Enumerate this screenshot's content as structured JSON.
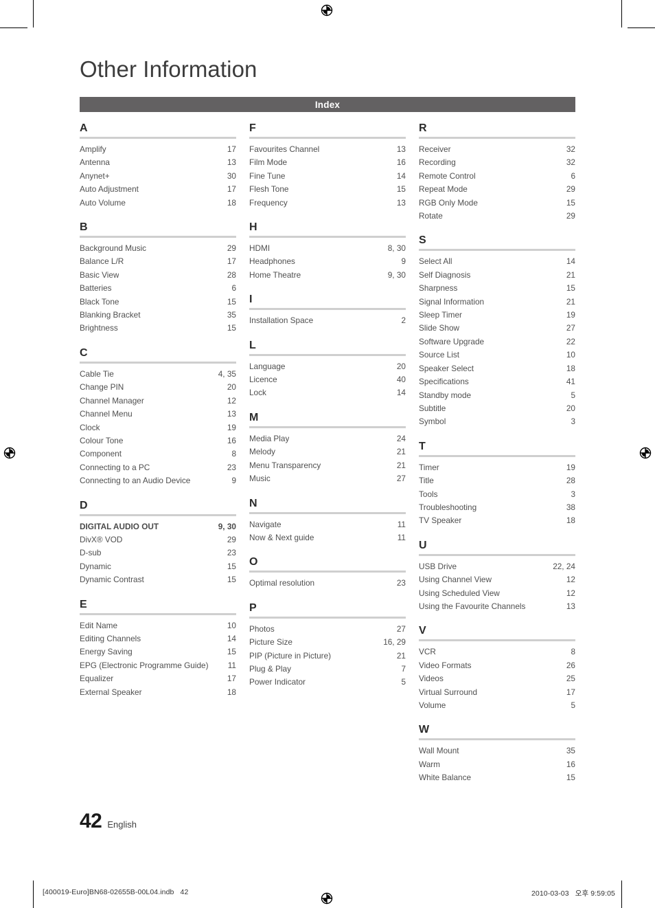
{
  "document": {
    "chapter_title": "Other Information",
    "section_bar_label": "Index",
    "page_number": "42",
    "language": "English",
    "slug_left": "[400019-Euro]BN68-02655B-00L04.indb   42",
    "slug_right": "2010-03-03   오후 9:59:05",
    "accent_bar_color": "#636162",
    "rule_color": "#cfcfcf",
    "text_color": "#4f4f4f"
  },
  "index": {
    "columns": [
      {
        "groups": [
          {
            "letter": "A",
            "entries": [
              {
                "label": "Amplify",
                "pages": "17"
              },
              {
                "label": "Antenna",
                "pages": "13"
              },
              {
                "label": "Anynet+",
                "pages": "30"
              },
              {
                "label": "Auto Adjustment",
                "pages": "17"
              },
              {
                "label": "Auto Volume",
                "pages": "18"
              }
            ]
          },
          {
            "letter": "B",
            "entries": [
              {
                "label": "Background Music",
                "pages": "29"
              },
              {
                "label": "Balance  L/R",
                "pages": "17"
              },
              {
                "label": "Basic View",
                "pages": "28"
              },
              {
                "label": "Batteries",
                "pages": "6"
              },
              {
                "label": "Black Tone",
                "pages": "15"
              },
              {
                "label": "Blanking Bracket",
                "pages": "35"
              },
              {
                "label": "Brightness",
                "pages": "15"
              }
            ]
          },
          {
            "letter": "C",
            "entries": [
              {
                "label": "Cable Tie",
                "pages": "4, 35"
              },
              {
                "label": "Change PIN",
                "pages": "20"
              },
              {
                "label": "Channel Manager",
                "pages": "12"
              },
              {
                "label": "Channel Menu",
                "pages": "13"
              },
              {
                "label": "Clock",
                "pages": "19"
              },
              {
                "label": "Colour Tone",
                "pages": "16"
              },
              {
                "label": "Component",
                "pages": "8"
              },
              {
                "label": "Connecting to a PC",
                "pages": "23"
              },
              {
                "label": "Connecting to an Audio Device",
                "pages": "9"
              }
            ]
          },
          {
            "letter": "D",
            "entries": [
              {
                "label": "DIGITAL AUDIO OUT",
                "pages": "9, 30",
                "bold": true
              },
              {
                "label": "DivX® VOD",
                "pages": "29"
              },
              {
                "label": "D-sub",
                "pages": "23"
              },
              {
                "label": "Dynamic",
                "pages": "15"
              },
              {
                "label": "Dynamic Contrast",
                "pages": "15"
              }
            ]
          },
          {
            "letter": "E",
            "entries": [
              {
                "label": "Edit Name",
                "pages": "10"
              },
              {
                "label": "Editing Channels",
                "pages": "14"
              },
              {
                "label": "Energy Saving",
                "pages": "15"
              },
              {
                "label": "EPG (Electronic Programme Guide)",
                "pages": "11"
              },
              {
                "label": "Equalizer",
                "pages": "17"
              },
              {
                "label": "External Speaker",
                "pages": "18"
              }
            ]
          }
        ]
      },
      {
        "groups": [
          {
            "letter": "F",
            "entries": [
              {
                "label": "Favourites Channel",
                "pages": "13"
              },
              {
                "label": "Film Mode",
                "pages": "16"
              },
              {
                "label": "Fine Tune",
                "pages": "14"
              },
              {
                "label": "Flesh Tone",
                "pages": "15"
              },
              {
                "label": "Frequency",
                "pages": "13"
              }
            ]
          },
          {
            "letter": "H",
            "entries": [
              {
                "label": "HDMI",
                "pages": "8, 30"
              },
              {
                "label": "Headphones",
                "pages": "9"
              },
              {
                "label": "Home Theatre",
                "pages": "9, 30"
              }
            ]
          },
          {
            "letter": "I",
            "entries": [
              {
                "label": "Installation Space",
                "pages": "2"
              }
            ]
          },
          {
            "letter": "L",
            "entries": [
              {
                "label": "Language",
                "pages": "20"
              },
              {
                "label": "Licence",
                "pages": "40"
              },
              {
                "label": "Lock",
                "pages": "14"
              }
            ]
          },
          {
            "letter": "M",
            "entries": [
              {
                "label": "Media Play",
                "pages": "24"
              },
              {
                "label": "Melody",
                "pages": "21"
              },
              {
                "label": "Menu Transparency",
                "pages": "21"
              },
              {
                "label": "Music",
                "pages": "27"
              }
            ]
          },
          {
            "letter": "N",
            "entries": [
              {
                "label": "Navigate",
                "pages": "11"
              },
              {
                "label": "Now & Next guide",
                "pages": "11"
              }
            ]
          },
          {
            "letter": "O",
            "entries": [
              {
                "label": "Optimal resolution",
                "pages": "23"
              }
            ]
          },
          {
            "letter": "P",
            "entries": [
              {
                "label": "Photos",
                "pages": "27"
              },
              {
                "label": "Picture Size",
                "pages": "16, 29"
              },
              {
                "label": "PIP (Picture in Picture)",
                "pages": "21"
              },
              {
                "label": "Plug & Play",
                "pages": "7"
              },
              {
                "label": "Power Indicator",
                "pages": "5"
              }
            ]
          }
        ]
      },
      {
        "groups": [
          {
            "letter": "R",
            "entries": [
              {
                "label": "Receiver",
                "pages": "32"
              },
              {
                "label": "Recording",
                "pages": "32"
              },
              {
                "label": "Remote Control",
                "pages": "6"
              },
              {
                "label": "Repeat Mode",
                "pages": "29"
              },
              {
                "label": "RGB Only Mode",
                "pages": "15"
              },
              {
                "label": "Rotate",
                "pages": "29"
              }
            ]
          },
          {
            "letter": "S",
            "entries": [
              {
                "label": "Select All",
                "pages": "14"
              },
              {
                "label": "Self Diagnosis",
                "pages": "21"
              },
              {
                "label": "Sharpness",
                "pages": "15"
              },
              {
                "label": "Signal Information",
                "pages": "21"
              },
              {
                "label": "Sleep Timer",
                "pages": "19"
              },
              {
                "label": "Slide Show",
                "pages": "27"
              },
              {
                "label": "Software Upgrade",
                "pages": "22"
              },
              {
                "label": "Source List",
                "pages": "10"
              },
              {
                "label": "Speaker Select",
                "pages": "18"
              },
              {
                "label": "Specifications",
                "pages": "41"
              },
              {
                "label": "Standby mode",
                "pages": "5"
              },
              {
                "label": "Subtitle",
                "pages": "20"
              },
              {
                "label": "Symbol",
                "pages": "3"
              }
            ]
          },
          {
            "letter": "T",
            "entries": [
              {
                "label": "Timer",
                "pages": "19"
              },
              {
                "label": "Title",
                "pages": "28"
              },
              {
                "label": "Tools",
                "pages": "3"
              },
              {
                "label": "Troubleshooting",
                "pages": "38"
              },
              {
                "label": "TV Speaker",
                "pages": "18"
              }
            ]
          },
          {
            "letter": "U",
            "entries": [
              {
                "label": "USB Drive",
                "pages": "22, 24"
              },
              {
                "label": "Using Channel View",
                "pages": "12"
              },
              {
                "label": "Using Scheduled View",
                "pages": "12"
              },
              {
                "label": "Using the Favourite Channels",
                "pages": "13"
              }
            ]
          },
          {
            "letter": "V",
            "entries": [
              {
                "label": "VCR",
                "pages": "8"
              },
              {
                "label": "Video Formats",
                "pages": "26"
              },
              {
                "label": "Videos",
                "pages": "25"
              },
              {
                "label": "Virtual Surround",
                "pages": "17"
              },
              {
                "label": "Volume",
                "pages": "5"
              }
            ]
          },
          {
            "letter": "W",
            "entries": [
              {
                "label": "Wall Mount",
                "pages": "35"
              },
              {
                "label": "Warm",
                "pages": "16"
              },
              {
                "label": "White Balance",
                "pages": "15"
              }
            ]
          }
        ]
      }
    ]
  }
}
